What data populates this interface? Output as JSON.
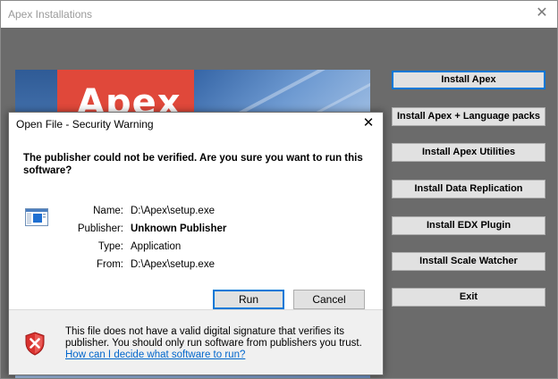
{
  "main_window": {
    "title": "Apex Installations",
    "close_glyph": "✕",
    "banner_text": "Apex"
  },
  "side_buttons": [
    {
      "label": "Install Apex"
    },
    {
      "label": "Install Apex + Language packs"
    },
    {
      "label": "Install Apex Utilities"
    },
    {
      "label": "Install Data Replication"
    },
    {
      "label": "Install EDX Plugin"
    },
    {
      "label": "Install Scale Watcher"
    },
    {
      "label": "Exit"
    }
  ],
  "dialog": {
    "title": "Open File - Security Warning",
    "close_glyph": "✕",
    "heading": "The publisher could not be verified.  Are you sure you want to run this software?",
    "file_info": [
      {
        "label": "Name:",
        "value": "D:\\Apex\\setup.exe"
      },
      {
        "label": "Publisher:",
        "value": "Unknown Publisher"
      },
      {
        "label": "Type:",
        "value": "Application"
      },
      {
        "label": "From:",
        "value": "D:\\Apex\\setup.exe"
      }
    ],
    "run_label": "Run",
    "cancel_label": "Cancel",
    "footer_text": "This file does not have a valid digital signature that verifies its publisher.  You should only run software from publishers you trust.",
    "footer_link": "How can I decide what software to run?"
  },
  "icons": {
    "file": "application-file-icon",
    "shield": "security-shield-warning-icon"
  },
  "colors": {
    "accent": "#0078d7",
    "banner_red": "#e0483a",
    "link": "#0066cc",
    "shield_red": "#d9322f"
  }
}
